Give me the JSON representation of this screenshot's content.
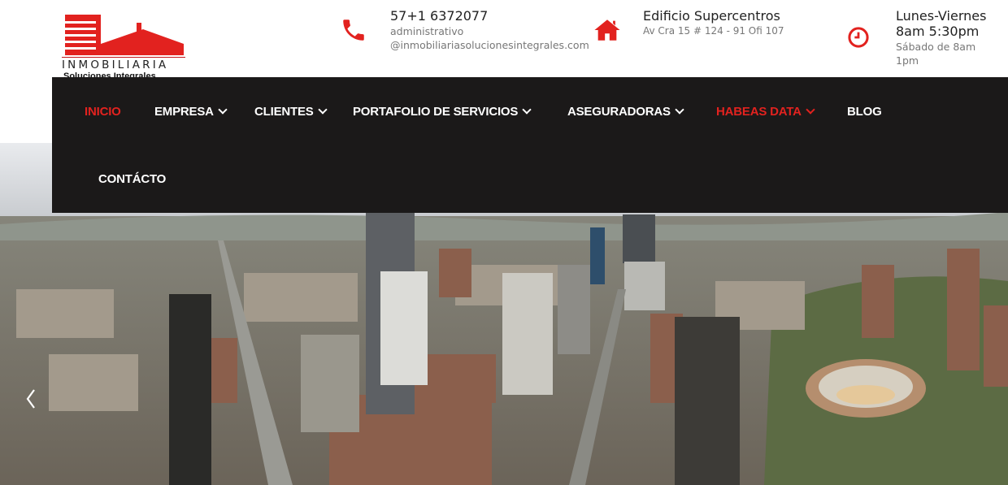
{
  "logo": {
    "brand": "INMOBILIARIA",
    "tagline": "Soluciones Integrales",
    "color": "#e2221f"
  },
  "contact": {
    "phone": {
      "icon": "phone-icon",
      "number": "57+1 6372077",
      "email_user": "administrativo",
      "email_domain": "@inmobiliariasolucionesintegrales.com"
    },
    "address": {
      "icon": "home-icon",
      "building": "Edificio Supercentros",
      "street": "Av Cra 15 # 124 - 91 Ofi 107"
    },
    "hours": {
      "icon": "clock-icon",
      "days": "Lunes-Viernes",
      "time": "8am 5:30pm",
      "saturday": "Sábado de 8am",
      "saturday_end": "1pm"
    }
  },
  "nav": {
    "items": [
      {
        "label": "INICIO",
        "active": true
      },
      {
        "label": "EMPRESA",
        "dropdown": true
      },
      {
        "label": "CLIENTES",
        "dropdown": true
      },
      {
        "label": "PORTAFOLIO DE SERVICIOS",
        "dropdown": true
      },
      {
        "label": "ASEGURADORAS",
        "dropdown": true
      },
      {
        "label": "HABEAS DATA",
        "dropdown": true,
        "highlight": true
      },
      {
        "label": "BLOG"
      },
      {
        "label": "CONTÁCTO"
      }
    ],
    "search_icon": "search-icon",
    "background": "#1b1919",
    "accent": "#e2221f"
  },
  "hero": {
    "description_icon": "chevron-left-icon"
  }
}
